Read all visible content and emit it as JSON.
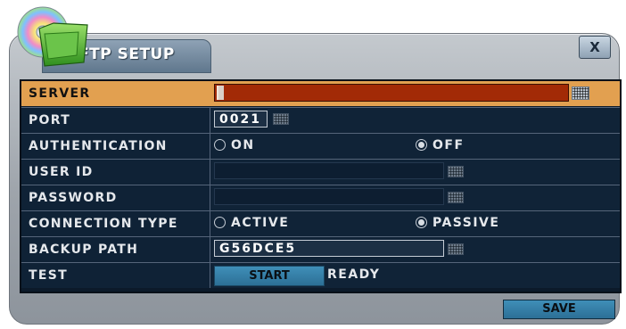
{
  "dialog": {
    "title": "FTP SETUP",
    "close_label": "X",
    "logo_icon": "ftp-disk-folder-icon"
  },
  "rows": {
    "server": {
      "label": "SERVER",
      "value": ""
    },
    "port": {
      "label": "PORT",
      "value": "0021"
    },
    "authentication": {
      "label": "AUTHENTICATION",
      "option_on": "ON",
      "option_off": "OFF",
      "selected": "OFF"
    },
    "user_id": {
      "label": "USER ID",
      "value": ""
    },
    "password": {
      "label": "PASSWORD",
      "value": ""
    },
    "connection_type": {
      "label": "CONNECTION TYPE",
      "option_active": "ACTIVE",
      "option_passive": "PASSIVE",
      "selected": "PASSIVE"
    },
    "backup_path": {
      "label": "BACKUP PATH",
      "value": "G56DCE5"
    },
    "test": {
      "label": "TEST",
      "button_label": "START",
      "status": "READY"
    }
  },
  "footer": {
    "save_label": "SAVE"
  },
  "colors": {
    "highlight": "#e2a050",
    "server_bar": "#a22a06",
    "button": "#3382ad",
    "panel": "#0c1a2a"
  }
}
